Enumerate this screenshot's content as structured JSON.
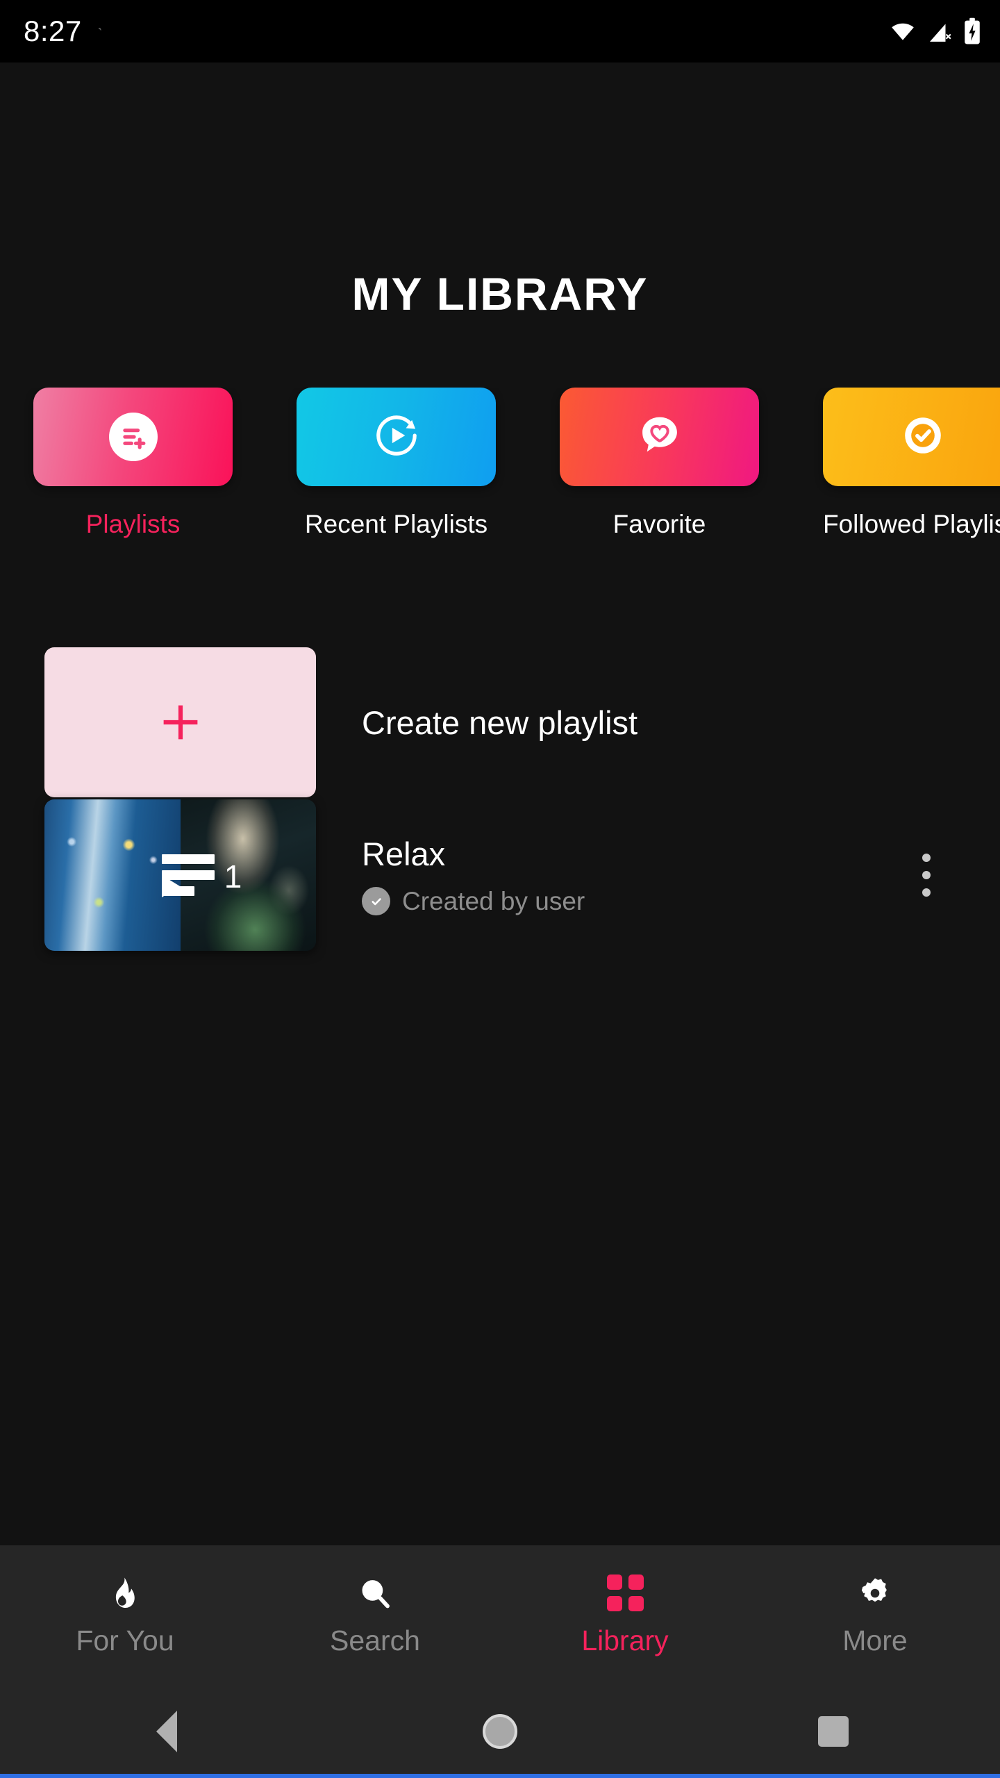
{
  "status_bar": {
    "time": "8:27",
    "left_glyph": "ˋ",
    "icons": [
      "wifi-icon",
      "cellular-off-icon",
      "battery-charging-icon"
    ]
  },
  "header": {
    "title": "MY LIBRARY"
  },
  "categories": [
    {
      "label": "Playlists",
      "icon": "playlist-add-icon",
      "active": true,
      "gradient_from": "#ef7fa4",
      "gradient_to": "#fa1259"
    },
    {
      "label": "Recent Playlists",
      "icon": "history-play-icon",
      "active": false,
      "gradient_from": "#12c8e6",
      "gradient_to": "#109ef0"
    },
    {
      "label": "Favorite",
      "icon": "heart-bubble-icon",
      "active": false,
      "gradient_from": "#fb5a33",
      "gradient_to": "#f01881"
    },
    {
      "label": "Followed Playlists",
      "icon": "check-circle-icon",
      "active": false,
      "gradient_from": "#fcbe1a",
      "gradient_to": "#f9a20c"
    }
  ],
  "library": {
    "create_row": {
      "label": "Create new playlist",
      "icon": "plus-icon"
    },
    "playlists": [
      {
        "title": "Relax",
        "subtitle": "Created by user",
        "subtitle_icon": "check-badge-icon",
        "count": "1",
        "overflow_icon": "more-vertical-icon"
      }
    ]
  },
  "bottom_tabs": [
    {
      "label": "For You",
      "icon": "flame-icon",
      "active": false
    },
    {
      "label": "Search",
      "icon": "search-icon",
      "active": false
    },
    {
      "label": "Library",
      "icon": "grid-icon",
      "active": true
    },
    {
      "label": "More",
      "icon": "gear-icon",
      "active": false
    }
  ],
  "system_nav": [
    {
      "name": "back",
      "icon": "triangle-back-icon"
    },
    {
      "name": "home",
      "icon": "circle-home-icon"
    },
    {
      "name": "recents",
      "icon": "square-recents-icon"
    }
  ],
  "colors": {
    "accent_pink": "#f5225c",
    "background": "#121212",
    "tab_bar": "#262626",
    "muted_text": "#8a8a8a"
  }
}
